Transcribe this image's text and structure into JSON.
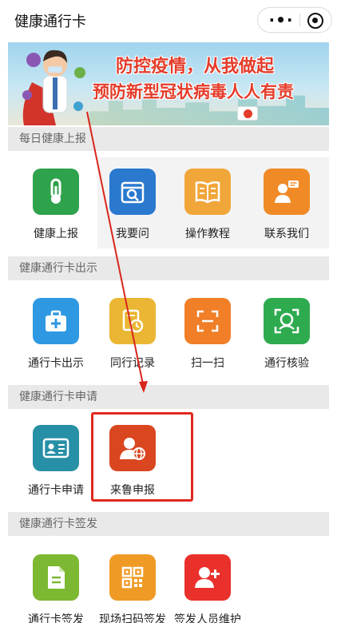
{
  "nav": {
    "title": "健康通行卡"
  },
  "banner": {
    "line1": "防控疫情，从我做起",
    "line2": "预防新型冠状病毒人人有责"
  },
  "sections": [
    {
      "title": "每日健康上报",
      "items": [
        {
          "label": "健康上报",
          "icon": "thermometer-icon",
          "color": "#2fa24c"
        },
        {
          "label": "我要问",
          "icon": "calendar-search-icon",
          "color": "#2a79cf"
        },
        {
          "label": "操作教程",
          "icon": "book-icon",
          "color": "#f1a63a"
        },
        {
          "label": "联系我们",
          "icon": "contact-icon",
          "color": "#ef8a26"
        }
      ]
    },
    {
      "title": "健康通行卡出示",
      "items": [
        {
          "label": "通行卡出示",
          "icon": "medical-kit-icon",
          "color": "#2f98e2"
        },
        {
          "label": "同行记录",
          "icon": "record-icon",
          "color": "#eab633"
        },
        {
          "label": "扫一扫",
          "icon": "scan-icon",
          "color": "#f07f28"
        },
        {
          "label": "通行核验",
          "icon": "face-verify-icon",
          "color": "#2fab4f"
        }
      ]
    },
    {
      "title": "健康通行卡申请",
      "items": [
        {
          "label": "通行卡申请",
          "icon": "id-card-icon",
          "color": "#2890a6"
        },
        {
          "label": "来鲁申报",
          "icon": "person-globe-icon",
          "color": "#d9461f"
        }
      ]
    },
    {
      "title": "健康通行卡签发",
      "items": [
        {
          "label": "通行卡签发",
          "icon": "document-icon",
          "color": "#7db832"
        },
        {
          "label": "现场扫码签发",
          "icon": "qrcode-icon",
          "color": "#f09a26"
        },
        {
          "label": "签发人员维护",
          "icon": "add-user-icon",
          "color": "#e9302a"
        }
      ]
    }
  ]
}
